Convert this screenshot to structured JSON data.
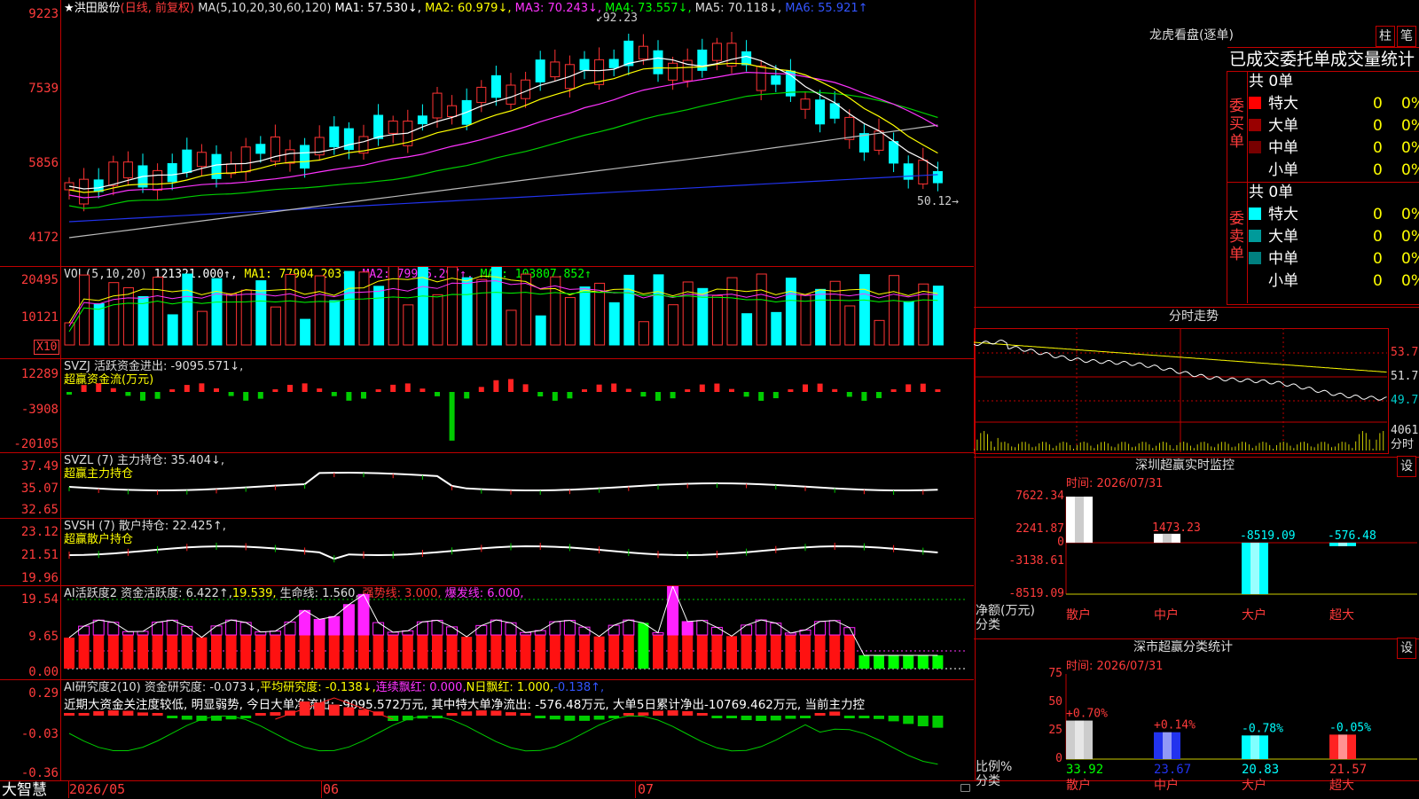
{
  "main": {
    "stock_name": "★洪田股份",
    "period_label": "(日线, 前复权)",
    "ma_prefix": "MA(5,10,20,30,60,120)",
    "ma": [
      {
        "label": "MA1: 57.530↓,",
        "color": "#ffffff"
      },
      {
        "label": "MA2: 60.979↓,",
        "color": "#ffff00"
      },
      {
        "label": "MA3: 70.243↓,",
        "color": "#ff33ff"
      },
      {
        "label": "MA4: 73.557↓,",
        "color": "#00ff00"
      },
      {
        "label": "MA5: 70.118↓,",
        "color": "#dddddd"
      },
      {
        "label": "MA6: 55.921↑",
        "color": "#3355ff"
      }
    ],
    "high_marker": "92.23",
    "low_marker": "50.12",
    "y_ticks": [
      "9223",
      "7539",
      "5856",
      "4172"
    ]
  },
  "vol": {
    "title": "VOL(5,10,20)",
    "value": "121321.000↑,",
    "ma1": "MA1: 77904.203↑,",
    "ma2": "MA2: 79926.297↑,",
    "ma3": "MA3: 103807.852↑",
    "y_ticks": [
      "20495",
      "10121"
    ],
    "unit": "X10"
  },
  "svzj": {
    "title": "SVZJ  活跃资金进出: -9095.571↓,",
    "subtitle": "超赢资金流(万元)",
    "y_ticks": [
      "12289",
      "-3908",
      "-20105"
    ]
  },
  "svzl": {
    "title": "SVZL (7) 主力持仓: 35.404↓,",
    "subtitle": "超赢主力持仓",
    "y_ticks": [
      "37.49",
      "35.07",
      "32.65"
    ]
  },
  "svsh": {
    "title": "SVSH (7) 散户持仓: 22.425↑,",
    "subtitle": "超赢散户持仓",
    "y_ticks": [
      "23.12",
      "21.51",
      "19.96"
    ]
  },
  "ai1": {
    "title": "AI活跃度2 资金活跃度: 6.422↑,",
    "v2": "19.539,",
    "life": "生命线: 1.560,",
    "strong": "强势线: 3.000,",
    "burst": "爆发线: 6.000,",
    "y_ticks": [
      "19.54",
      "9.65",
      "0.00"
    ]
  },
  "ai2": {
    "title": "AI研究度2(10) 资金研究度: -0.073↓,",
    "avg": "平均研究度: -0.138↓,",
    "cont": "连续飘红: 0.000,",
    "nday": "N日飘红: 1.000,",
    "last": "-0.138↑,",
    "commentary": "近期大资金关注度较低, 明显弱势, 今日大单净流出: -9095.572万元, 其中特大单净流出: -576.48万元, 大单5日累计净出-10769.462万元, 当前主力控",
    "y_ticks": [
      "0.29",
      "-0.03",
      "-0.36"
    ]
  },
  "bottom": {
    "brand": "大智慧",
    "dates": [
      "2026/05",
      "06",
      "07"
    ]
  },
  "dragon": {
    "title": "龙虎看盘(逐单)",
    "btn_zhu": "柱",
    "btn_bi": "笔",
    "header": "已成交委托单成交量统计",
    "buy_label": "委买单",
    "sell_label": "委卖单",
    "buy_total": "共 0单",
    "sell_total": "共 0单",
    "buy_rows": [
      {
        "name": "特大",
        "count": "0",
        "pct": "0%",
        "color": "#ff0000"
      },
      {
        "name": "大单",
        "count": "0",
        "pct": "0%",
        "color": "#990000"
      },
      {
        "name": "中单",
        "count": "0",
        "pct": "0%",
        "color": "#770000"
      },
      {
        "name": "小单",
        "count": "0",
        "pct": "0%",
        "color": "#000000"
      }
    ],
    "sell_rows": [
      {
        "name": "特大",
        "count": "0",
        "pct": "0%",
        "color": "#00ffff"
      },
      {
        "name": "大单",
        "count": "0",
        "pct": "0%",
        "color": "#009a9a"
      },
      {
        "name": "中单",
        "count": "0",
        "pct": "0%",
        "color": "#008080"
      },
      {
        "name": "小单",
        "count": "0",
        "pct": "0%",
        "color": "#000000"
      }
    ]
  },
  "intraday": {
    "title": "分时走势",
    "prices": [
      "53.70",
      "51.70",
      "49.70"
    ],
    "vol_top": "4061",
    "vol_label": "分时"
  },
  "monitor": {
    "title": "深圳超赢实时监控",
    "btn": "设",
    "time": "时间: 2026/07/31",
    "y_ticks": [
      "7622.34",
      "2241.87",
      "0",
      "-3138.61",
      "-8519.09"
    ],
    "y_label": "净额(万元)",
    "cat_label": "分类",
    "categories": [
      "散户",
      "中户",
      "大户",
      "超大"
    ],
    "values": [
      7622.34,
      1473.23,
      -8519.09,
      -576.48
    ],
    "value_labels": [
      "7622.34",
      "1473.23",
      "-8519.09",
      "-576.48"
    ],
    "ylim": [
      -8519.09,
      7622.34
    ]
  },
  "classify": {
    "title": "深市超赢分类统计",
    "btn": "设",
    "time": "时间: 2026/07/31",
    "y_ticks": [
      "75",
      "50",
      "25",
      "0"
    ],
    "y_label": "比例%",
    "cat_label": "分类",
    "categories": [
      "散户",
      "中户",
      "大户",
      "超大"
    ],
    "ratios": [
      33.92,
      23.67,
      20.83,
      21.57
    ],
    "ratio_labels": [
      "33.92",
      "23.67",
      "20.83",
      "21.57"
    ],
    "changes": [
      "+0.70%",
      "+0.14%",
      "-0.78%",
      "-0.05%"
    ],
    "ylim": [
      0,
      75
    ]
  },
  "chart_data": [
    {
      "type": "bar",
      "title": "深圳超赢实时监控",
      "categories": [
        "散户",
        "中户",
        "大户",
        "超大"
      ],
      "series": [
        {
          "values": [
            7622.34,
            1473.23,
            -8519.09,
            -576.48
          ]
        }
      ],
      "ylabel": "净额(万元)",
      "xlabel": "分类",
      "ylim": [
        -8519.09,
        7622.34
      ]
    },
    {
      "type": "bar",
      "title": "深市超赢分类统计",
      "categories": [
        "散户",
        "中户",
        "大户",
        "超大"
      ],
      "series": [
        {
          "values": [
            33.92,
            23.67,
            20.83,
            21.57
          ]
        }
      ],
      "ylabel": "比例%",
      "xlabel": "分类",
      "ylim": [
        0,
        75
      ]
    }
  ]
}
